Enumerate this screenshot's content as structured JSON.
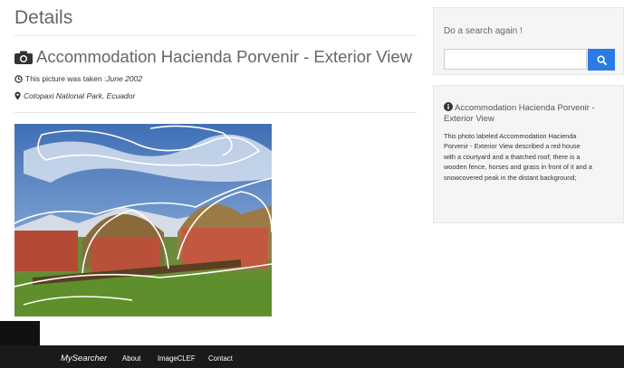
{
  "page": {
    "title": "Details"
  },
  "photo": {
    "title": "Accommodation Hacienda Porvenir - Exterior View",
    "taken_label": "This picture was taken : ",
    "taken_date": "June 2002",
    "location": "Cotopaxi National Park, Ecuador",
    "icons": {
      "camera": "camera-icon",
      "clock": "clock-icon",
      "location": "map-marker-icon"
    }
  },
  "search": {
    "label": "Do a search again !",
    "value": "",
    "placeholder": "",
    "button_icon": "search-icon"
  },
  "info": {
    "title": "Accommodation Hacienda Porvenir - Exterior View",
    "description": "This photo labeled Accommodation Hacienda Porvenir - Exterior View described a red house with a courtyard and a thatched roof; there is a wooden fence, horses and grass in front of it and a snowcovered peak in the distant background;",
    "icon": "info-circle-icon"
  },
  "footer": {
    "brand": "MySearcher",
    "links": [
      "About",
      "ImageCLEF",
      "Contact"
    ]
  },
  "colors": {
    "accent": "#2b7be4",
    "footer": "#1a1a1a",
    "panel": "#f5f5f5"
  }
}
